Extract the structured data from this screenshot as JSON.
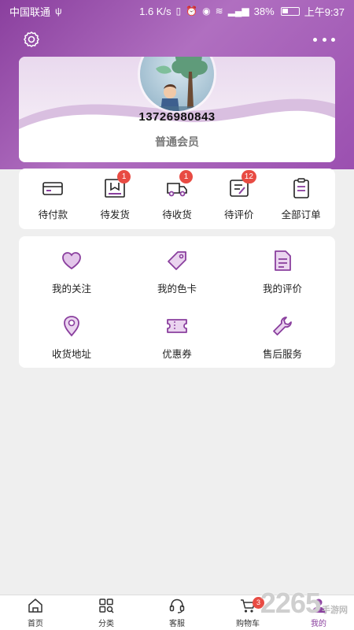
{
  "status_bar": {
    "carrier": "中国联通",
    "speed": "1.6 K/s",
    "battery": "38%",
    "time": "上午9:37"
  },
  "profile": {
    "phone": "13726980843",
    "level": "普通会员"
  },
  "orders": [
    {
      "label": "待付款",
      "icon": "wallet-icon",
      "badge": ""
    },
    {
      "label": "待发货",
      "icon": "package-icon",
      "badge": "1"
    },
    {
      "label": "待收货",
      "icon": "truck-icon",
      "badge": "1"
    },
    {
      "label": "待评价",
      "icon": "review-icon",
      "badge": "12"
    },
    {
      "label": "全部订单",
      "icon": "clipboard-icon",
      "badge": ""
    }
  ],
  "services": [
    {
      "label": "我的关注",
      "icon": "heart-icon"
    },
    {
      "label": "我的色卡",
      "icon": "tag-icon"
    },
    {
      "label": "我的评价",
      "icon": "document-icon"
    },
    {
      "label": "收货地址",
      "icon": "location-icon"
    },
    {
      "label": "优惠券",
      "icon": "coupon-icon"
    },
    {
      "label": "售后服务",
      "icon": "wrench-icon"
    }
  ],
  "tabs": [
    {
      "label": "首页",
      "icon": "home-icon"
    },
    {
      "label": "分类",
      "icon": "category-icon"
    },
    {
      "label": "客服",
      "icon": "headset-icon"
    },
    {
      "label": "购物车",
      "icon": "cart-icon",
      "badge": "3"
    },
    {
      "label": "我的",
      "icon": "user-icon",
      "active": true
    }
  ],
  "watermark": {
    "number": "2265",
    "site": "手游网"
  },
  "colors": {
    "accent": "#8a3f9e",
    "accent_light": "#c89ad4",
    "badge": "#e84b43"
  }
}
